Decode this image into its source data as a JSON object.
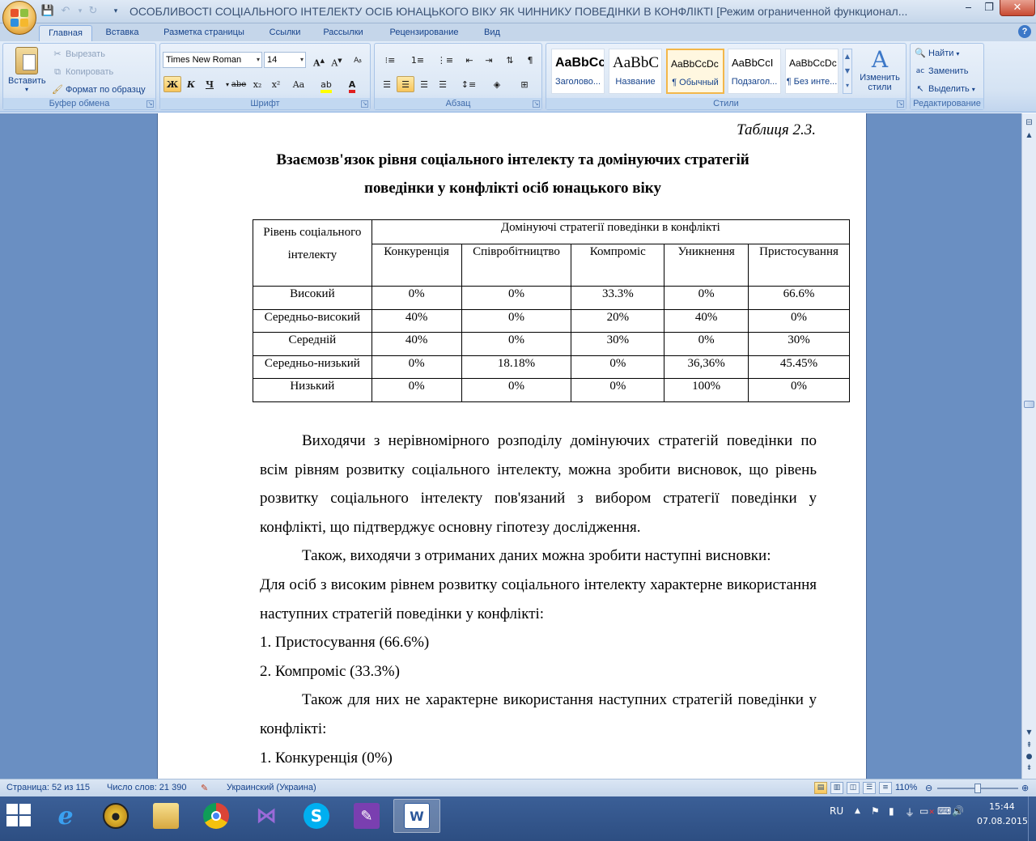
{
  "window": {
    "title": "ОСОБЛИВОСТІ СОЦІАЛЬНОГО ІНТЕЛЕКТУ ОСІБ ЮНАЦЬКОГО ВІКУ ЯК ЧИННИКУ ПОВЕДІНКИ В КОНФЛІКТІ [Режим ограниченной функционал..."
  },
  "ribbon_tabs": [
    "Главная",
    "Вставка",
    "Разметка страницы",
    "Ссылки",
    "Рассылки",
    "Рецензирование",
    "Вид"
  ],
  "clipboard": {
    "paste": "Вставить",
    "cut": "Вырезать",
    "copy": "Копировать",
    "format_painter": "Формат по образцу",
    "label": "Буфер обмена"
  },
  "font": {
    "name": "Times New Roman",
    "size": "14",
    "label": "Шрифт",
    "bold": "Ж",
    "italic": "К",
    "underline": "Ч",
    "strike": "abe",
    "subscript": "x₂",
    "superscript": "x²",
    "case": "Aa"
  },
  "paragraph": {
    "label": "Абзац"
  },
  "styles": {
    "items": [
      {
        "preview": "AaBbCc",
        "name": "Заголово..."
      },
      {
        "preview": "AaBbC",
        "name": "Название"
      },
      {
        "preview": "AaBbCcDc",
        "name": "¶ Обычный"
      },
      {
        "preview": "AaBbCcI",
        "name": "Подзагол..."
      },
      {
        "preview": "AaBbCcDc",
        "name": "¶ Без инте..."
      }
    ],
    "change_styles": "Изменить стили",
    "label": "Стили"
  },
  "editing": {
    "find": "Найти",
    "replace": "Заменить",
    "select": "Выделить",
    "label": "Редактирование"
  },
  "document": {
    "table_caption": "Таблиця 2.3.",
    "table_title_line1": "Взаємозв'язок рівня соціального інтелекту та домінуючих стратегій",
    "table_title_line2": "поведінки у конфлікті осіб юнацького віку",
    "table": {
      "row_header": "Рівень соціального інтелекту",
      "group_header": "Домінуючі стратегії поведінки в конфлікті",
      "columns": [
        "Конкуренція",
        "Співробітництво",
        "Компроміс",
        "Уникнення",
        "Пристосування"
      ],
      "rows": [
        {
          "level": "Високий",
          "values": [
            "0%",
            "0%",
            "33.3%",
            "0%",
            "66.6%"
          ]
        },
        {
          "level": "Середньо-високий",
          "values": [
            "40%",
            "0%",
            "20%",
            "40%",
            "0%"
          ]
        },
        {
          "level": "Середній",
          "values": [
            "40%",
            "0%",
            "30%",
            "0%",
            "30%"
          ]
        },
        {
          "level": "Середньо-низький",
          "values": [
            "0%",
            "18.18%",
            "0%",
            "36,36%",
            "45.45%"
          ]
        },
        {
          "level": "Низький",
          "values": [
            "0%",
            "0%",
            "0%",
            "100%",
            "0%"
          ]
        }
      ]
    },
    "paragraphs": [
      "Виходячи з нерівномірного розподілу домінуючих стратегій поведінки по всім рівням розвитку соціального інтелекту, можна зробити висновок, що рівень розвитку соціального інтелекту пов'язаний з вибором стратегії поведінки у конфлікті, що підтверджує основну гіпотезу дослідження.",
      "Також, виходячи з отриманих даних можна зробити наступні висновки:",
      "Для осіб з високим рівнем розвитку соціального інтелекту характерне використання наступних стратегій поведінки у конфлікті:",
      "1. Пристосування (66.6%)",
      "2. Компроміс (33.3%)",
      "Також для них не характерне використання наступних стратегій поведінки у конфлікті:",
      "1. Конкуренція (0%)"
    ]
  },
  "status": {
    "page": "Страница: 52 из 115",
    "words": "Число слов: 21 390",
    "language": "Украинский (Украина)",
    "zoom": "110%"
  },
  "taskbar": {
    "lang": "RU",
    "time": "15:44",
    "date": "07.08.2015",
    "apps": [
      "internet-explorer",
      "media-player",
      "file-explorer",
      "chrome",
      "visual-studio",
      "skype",
      "onenote",
      "word"
    ]
  },
  "colors": {
    "ribbon_bg": "#dbe7f5",
    "workspace_bg": "#6a8fc2",
    "taskbar_bg": "#2d4e82",
    "accent": "#15428b"
  }
}
